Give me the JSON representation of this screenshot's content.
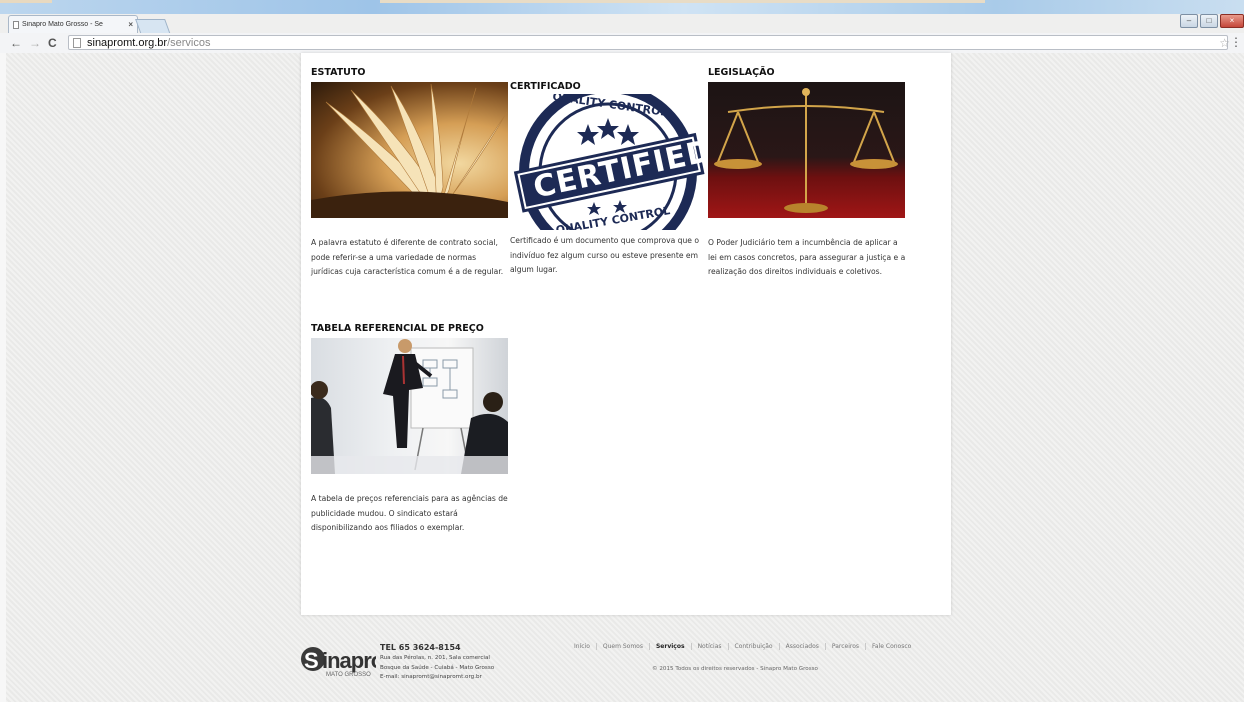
{
  "browser": {
    "tab_title": "Sinapro Mato Grosso - Se",
    "tab_close": "×",
    "url_domain": "sinapromt.org.br",
    "url_path": "/servicos",
    "window_buttons": [
      "–",
      "□",
      "×"
    ]
  },
  "services": [
    {
      "title": "ESTATUTO",
      "text": "A palavra estatuto é diferente de contrato social, pode referir-se a uma variedade de normas jurídicas cuja característica comum é a de regular."
    },
    {
      "title": "CERTIFICADO",
      "text": "Certificado é um documento que comprova que o indivíduo fez algum curso ou esteve presente em algum lugar.",
      "stamp_top": "QUALITY CONTROL",
      "stamp_main": "CERTIFIED",
      "stamp_bottom": "QUALITY CONTROL"
    },
    {
      "title": "LEGISLAÇÃO",
      "text": "O Poder Judiciário tem a incumbência de aplicar a lei em casos concretos, para assegurar a justiça e a realização dos direitos individuais e coletivos."
    },
    {
      "title": "TABELA REFERENCIAL DE PREÇO",
      "text": "A tabela de preços referenciais para as agências de publicidade mudou. O sindicato estará disponibilizando aos filiados o exemplar."
    }
  ],
  "footer": {
    "logo_text": "Sinapro",
    "logo_sub": "MATO GROSSO",
    "tel": "TEL 65 3624-8154",
    "address_1": "Rua das Pérolas, n. 201, Sala comercial",
    "address_2": "Bosque da Saúde - Cuiabá - Mato Grosso",
    "email": "E-mail: sinapromt@sinapromt.org.br",
    "nav": [
      "Início",
      "Quem Somos",
      "Serviços",
      "Notícias",
      "Contribuição",
      "Associados",
      "Parceiros",
      "Fale Conosco"
    ],
    "active_nav": "Serviços",
    "copyright": "© 2015 Todos os direitos reservados - Sinapro Mato Grosso"
  },
  "colors": {
    "page_background": "#efefee",
    "content_background": "#ffffff",
    "text": "#333333"
  }
}
